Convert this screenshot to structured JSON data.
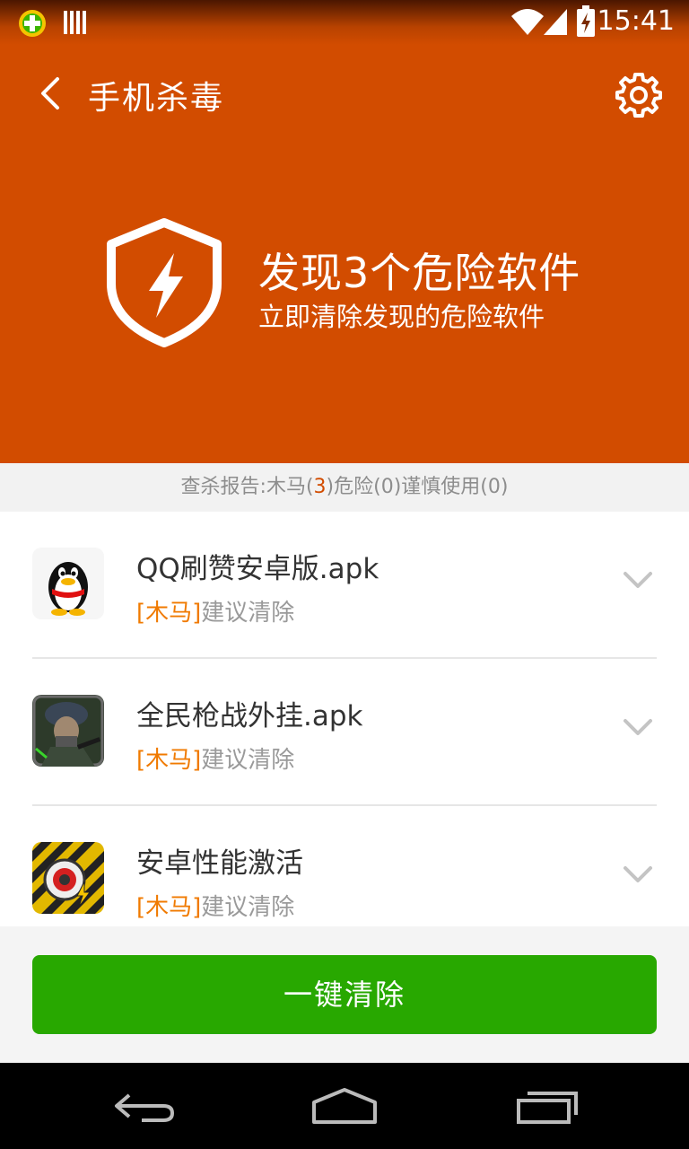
{
  "status_bar": {
    "time": "15:41"
  },
  "appbar": {
    "title": "手机杀毒"
  },
  "hero": {
    "headline": "发现3个危险软件",
    "subline": "立即清除发现的危险软件"
  },
  "report": {
    "prefix": "查杀报告:木马(",
    "trojan_count": "3",
    "suffix": ")危险(0)谨慎使用(0)"
  },
  "items": [
    {
      "name": "QQ刷赞安卓版.apk",
      "tag": "[木马]",
      "advice": "建议清除",
      "icon": "qq-penguin-icon"
    },
    {
      "name": "全民枪战外挂.apk",
      "tag": "[木马]",
      "advice": "建议清除",
      "icon": "soldier-game-icon"
    },
    {
      "name": "安卓性能激活",
      "tag": "[木马]",
      "advice": "建议清除",
      "icon": "performance-boost-icon"
    }
  ],
  "footer": {
    "clean_button": "一键清除"
  },
  "colors": {
    "accent": "#d24c00",
    "button": "#28a800",
    "trojan": "#f07a00"
  }
}
